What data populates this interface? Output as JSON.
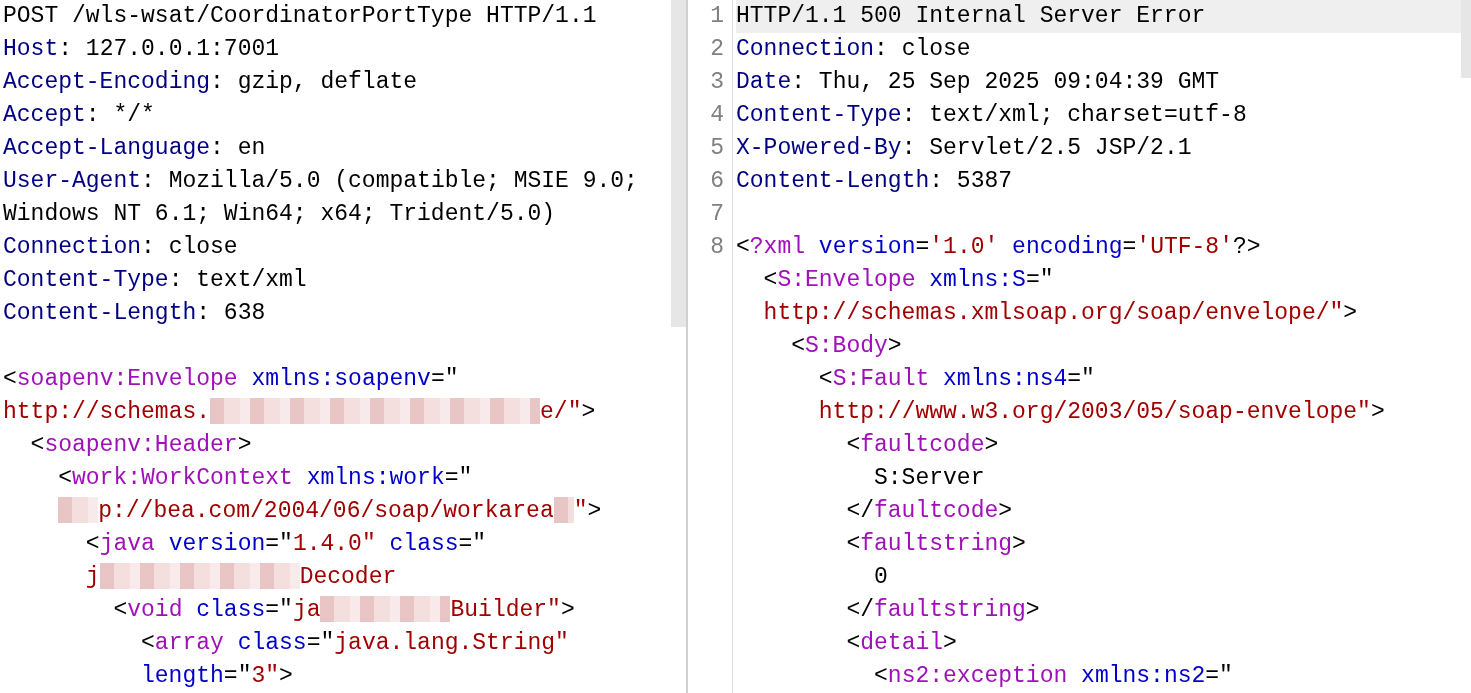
{
  "request": {
    "lines": [
      {
        "segments": [
          {
            "kind": "plain",
            "text": "POST /wls-wsat/CoordinatorPortType HTTP/1.1"
          }
        ]
      },
      {
        "segments": [
          {
            "kind": "header",
            "text": "Host"
          },
          {
            "kind": "plain",
            "text": ": 127.0.0.1:7001"
          }
        ]
      },
      {
        "segments": [
          {
            "kind": "header",
            "text": "Accept-Encoding"
          },
          {
            "kind": "plain",
            "text": ": gzip, deflate"
          }
        ]
      },
      {
        "segments": [
          {
            "kind": "header",
            "text": "Accept"
          },
          {
            "kind": "plain",
            "text": ": */*"
          }
        ]
      },
      {
        "segments": [
          {
            "kind": "header",
            "text": "Accept-Language"
          },
          {
            "kind": "plain",
            "text": ": en"
          }
        ]
      },
      {
        "segments": [
          {
            "kind": "header",
            "text": "User-Agent"
          },
          {
            "kind": "plain",
            "text": ": Mozilla/5.0 (compatible; MSIE 9.0;"
          }
        ],
        "continuation": [
          {
            "kind": "plain",
            "text": "Windows NT 6.1; Win64; x64; Trident/5.0)"
          }
        ]
      },
      {
        "segments": [
          {
            "kind": "header",
            "text": "Connection"
          },
          {
            "kind": "plain",
            "text": ": close"
          }
        ]
      },
      {
        "segments": [
          {
            "kind": "header",
            "text": "Content-Type"
          },
          {
            "kind": "plain",
            "text": ": text/xml"
          }
        ]
      },
      {
        "segments": [
          {
            "kind": "header",
            "text": "Content-Length"
          },
          {
            "kind": "plain",
            "text": ": 638"
          }
        ]
      },
      {
        "blank_before": true,
        "segments": [
          {
            "kind": "plain",
            "text": "<"
          },
          {
            "kind": "tag",
            "text": "soapenv:Envelope"
          },
          {
            "kind": "space"
          },
          {
            "kind": "attr",
            "text": "xmlns:soapenv"
          },
          {
            "kind": "plain",
            "text": "=\""
          }
        ],
        "continuation": [
          {
            "kind": "value",
            "text": "http://schemas."
          },
          {
            "kind": "redaction"
          },
          {
            "kind": "value",
            "text": "e/\""
          },
          {
            "kind": "plain",
            "text": ">"
          }
        ],
        "children": [
          {
            "segments": [
              {
                "kind": "plain",
                "text": "<"
              },
              {
                "kind": "tag",
                "text": "soapenv:Header"
              },
              {
                "kind": "plain",
                "text": ">"
              }
            ],
            "children": [
              {
                "segments": [
                  {
                    "kind": "plain",
                    "text": "<"
                  },
                  {
                    "kind": "tag",
                    "text": "work:WorkContext"
                  },
                  {
                    "kind": "space"
                  },
                  {
                    "kind": "attr",
                    "text": "xmlns:work"
                  },
                  {
                    "kind": "plain",
                    "text": "=\""
                  }
                ],
                "continuation": [
                  {
                    "kind": "redaction"
                  },
                  {
                    "kind": "value",
                    "text": "p://bea.com/2004/06/soap/workarea"
                  },
                  {
                    "kind": "redaction"
                  },
                  {
                    "kind": "value",
                    "text": "\""
                  },
                  {
                    "kind": "plain",
                    "text": ">"
                  }
                ],
                "children": [
                  {
                    "segments": [
                      {
                        "kind": "plain",
                        "text": "<"
                      },
                      {
                        "kind": "tag",
                        "text": "java"
                      },
                      {
                        "kind": "space"
                      },
                      {
                        "kind": "attr",
                        "text": "version"
                      },
                      {
                        "kind": "plain",
                        "text": "=\""
                      },
                      {
                        "kind": "value",
                        "text": "1.4.0\""
                      },
                      {
                        "kind": "space"
                      },
                      {
                        "kind": "attr",
                        "text": "class"
                      },
                      {
                        "kind": "plain",
                        "text": "=\""
                      }
                    ],
                    "continuation": [
                      {
                        "kind": "value",
                        "text": "j"
                      },
                      {
                        "kind": "redaction"
                      },
                      {
                        "kind": "value",
                        "text": "Decoder"
                      }
                    ],
                    "children": [
                      {
                        "segments": [
                          {
                            "kind": "plain",
                            "text": "<"
                          },
                          {
                            "kind": "tag",
                            "text": "void"
                          },
                          {
                            "kind": "space"
                          },
                          {
                            "kind": "attr",
                            "text": "class"
                          },
                          {
                            "kind": "plain",
                            "text": "=\""
                          },
                          {
                            "kind": "value",
                            "text": "ja"
                          },
                          {
                            "kind": "redaction"
                          },
                          {
                            "kind": "value",
                            "text": "Builder\""
                          },
                          {
                            "kind": "plain",
                            "text": ">"
                          }
                        ],
                        "children": [
                          {
                            "segments": [
                              {
                                "kind": "plain",
                                "text": "<"
                              },
                              {
                                "kind": "tag",
                                "text": "array"
                              },
                              {
                                "kind": "space"
                              },
                              {
                                "kind": "attr",
                                "text": "class"
                              },
                              {
                                "kind": "plain",
                                "text": "=\""
                              },
                              {
                                "kind": "value",
                                "text": "java.lang.String\""
                              }
                            ],
                            "continuation": [
                              {
                                "kind": "attr",
                                "text": "length"
                              },
                              {
                                "kind": "plain",
                                "text": "=\""
                              },
                              {
                                "kind": "value",
                                "text": "3\""
                              },
                              {
                                "kind": "plain",
                                "text": ">"
                              }
                            ]
                          }
                        ]
                      }
                    ]
                  }
                ]
              }
            ]
          }
        ]
      }
    ]
  },
  "response": {
    "lines": [
      {
        "number": "1",
        "selected": true,
        "segments": [
          {
            "kind": "plain",
            "text": "HTTP/1.1 500 Internal Server Error"
          }
        ]
      },
      {
        "number": "2",
        "selected": false,
        "segments": [
          {
            "kind": "header",
            "text": "Connection"
          },
          {
            "kind": "plain",
            "text": ": close"
          }
        ]
      },
      {
        "number": "3",
        "selected": false,
        "segments": [
          {
            "kind": "header",
            "text": "Date"
          },
          {
            "kind": "plain",
            "text": ": Thu, 25 Sep 2025 09:04:39 GMT"
          }
        ]
      },
      {
        "number": "4",
        "selected": false,
        "segments": [
          {
            "kind": "header",
            "text": "Content-Type"
          },
          {
            "kind": "plain",
            "text": ": text/xml; charset=utf-8"
          }
        ]
      },
      {
        "number": "5",
        "selected": false,
        "segments": [
          {
            "kind": "header",
            "text": "X-Powered-By"
          },
          {
            "kind": "plain",
            "text": ": Servlet/2.5 JSP/2.1"
          }
        ]
      },
      {
        "number": "6",
        "selected": false,
        "segments": [
          {
            "kind": "header",
            "text": "Content-Length"
          },
          {
            "kind": "plain",
            "text": ": 5387"
          }
        ]
      },
      {
        "number": "7",
        "selected": false
      },
      {
        "number": "8",
        "selected": false,
        "segments": [
          {
            "kind": "plain",
            "text": "<"
          },
          {
            "kind": "tag",
            "text": "?xml"
          },
          {
            "kind": "space"
          },
          {
            "kind": "attr",
            "text": "version"
          },
          {
            "kind": "plain",
            "text": "="
          },
          {
            "kind": "value",
            "text": "'1.0'"
          },
          {
            "kind": "space"
          },
          {
            "kind": "attr",
            "text": "encoding"
          },
          {
            "kind": "plain",
            "text": "="
          },
          {
            "kind": "value",
            "text": "'UTF-8'"
          },
          {
            "kind": "plain",
            "text": "?>"
          }
        ],
        "children": [
          {
            "segments": [
              {
                "kind": "plain",
                "text": "<"
              },
              {
                "kind": "tag",
                "text": "S:Envelope"
              },
              {
                "kind": "space"
              },
              {
                "kind": "attr",
                "text": "xmlns:S"
              },
              {
                "kind": "plain",
                "text": "=\""
              }
            ],
            "continuation": [
              {
                "kind": "value",
                "text": "http://schemas.xmlsoap.org/soap/envelope/\""
              },
              {
                "kind": "plain",
                "text": ">"
              }
            ],
            "children": [
              {
                "segments": [
                  {
                    "kind": "plain",
                    "text": "<"
                  },
                  {
                    "kind": "tag",
                    "text": "S:Body"
                  },
                  {
                    "kind": "plain",
                    "text": ">"
                  }
                ],
                "children": [
                  {
                    "segments": [
                      {
                        "kind": "plain",
                        "text": "<"
                      },
                      {
                        "kind": "tag",
                        "text": "S:Fault"
                      },
                      {
                        "kind": "space"
                      },
                      {
                        "kind": "attr",
                        "text": "xmlns:ns4"
                      },
                      {
                        "kind": "plain",
                        "text": "=\""
                      }
                    ],
                    "continuation": [
                      {
                        "kind": "value",
                        "text": "http://www.w3.org/2003/05/soap-envelope\""
                      },
                      {
                        "kind": "plain",
                        "text": ">"
                      }
                    ],
                    "children": [
                      {
                        "segments": [
                          {
                            "kind": "plain",
                            "text": "<"
                          },
                          {
                            "kind": "tag",
                            "text": "faultcode"
                          },
                          {
                            "kind": "plain",
                            "text": ">"
                          }
                        ],
                        "children": [
                          {
                            "segments": [
                              {
                                "kind": "plain",
                                "text": "S:Server"
                              }
                            ]
                          }
                        ]
                      },
                      {
                        "segments": [
                          {
                            "kind": "plain",
                            "text": "</"
                          },
                          {
                            "kind": "tag",
                            "text": "faultcode"
                          },
                          {
                            "kind": "plain",
                            "text": ">"
                          }
                        ]
                      },
                      {
                        "segments": [
                          {
                            "kind": "plain",
                            "text": "<"
                          },
                          {
                            "kind": "tag",
                            "text": "faultstring"
                          },
                          {
                            "kind": "plain",
                            "text": ">"
                          }
                        ],
                        "children": [
                          {
                            "segments": [
                              {
                                "kind": "plain",
                                "text": "0"
                              }
                            ]
                          }
                        ]
                      },
                      {
                        "segments": [
                          {
                            "kind": "plain",
                            "text": "</"
                          },
                          {
                            "kind": "tag",
                            "text": "faultstring"
                          },
                          {
                            "kind": "plain",
                            "text": ">"
                          }
                        ]
                      },
                      {
                        "segments": [
                          {
                            "kind": "plain",
                            "text": "<"
                          },
                          {
                            "kind": "tag",
                            "text": "detail"
                          },
                          {
                            "kind": "plain",
                            "text": ">"
                          }
                        ],
                        "children": [
                          {
                            "segments": [
                              {
                                "kind": "plain",
                                "text": "<"
                              },
                              {
                                "kind": "tag",
                                "text": "ns2:exception"
                              },
                              {
                                "kind": "space"
                              },
                              {
                                "kind": "attr",
                                "text": "xmlns:ns2"
                              },
                              {
                                "kind": "plain",
                                "text": "=\""
                              }
                            ]
                          }
                        ]
                      }
                    ]
                  }
                ]
              }
            ]
          }
        ]
      }
    ]
  }
}
